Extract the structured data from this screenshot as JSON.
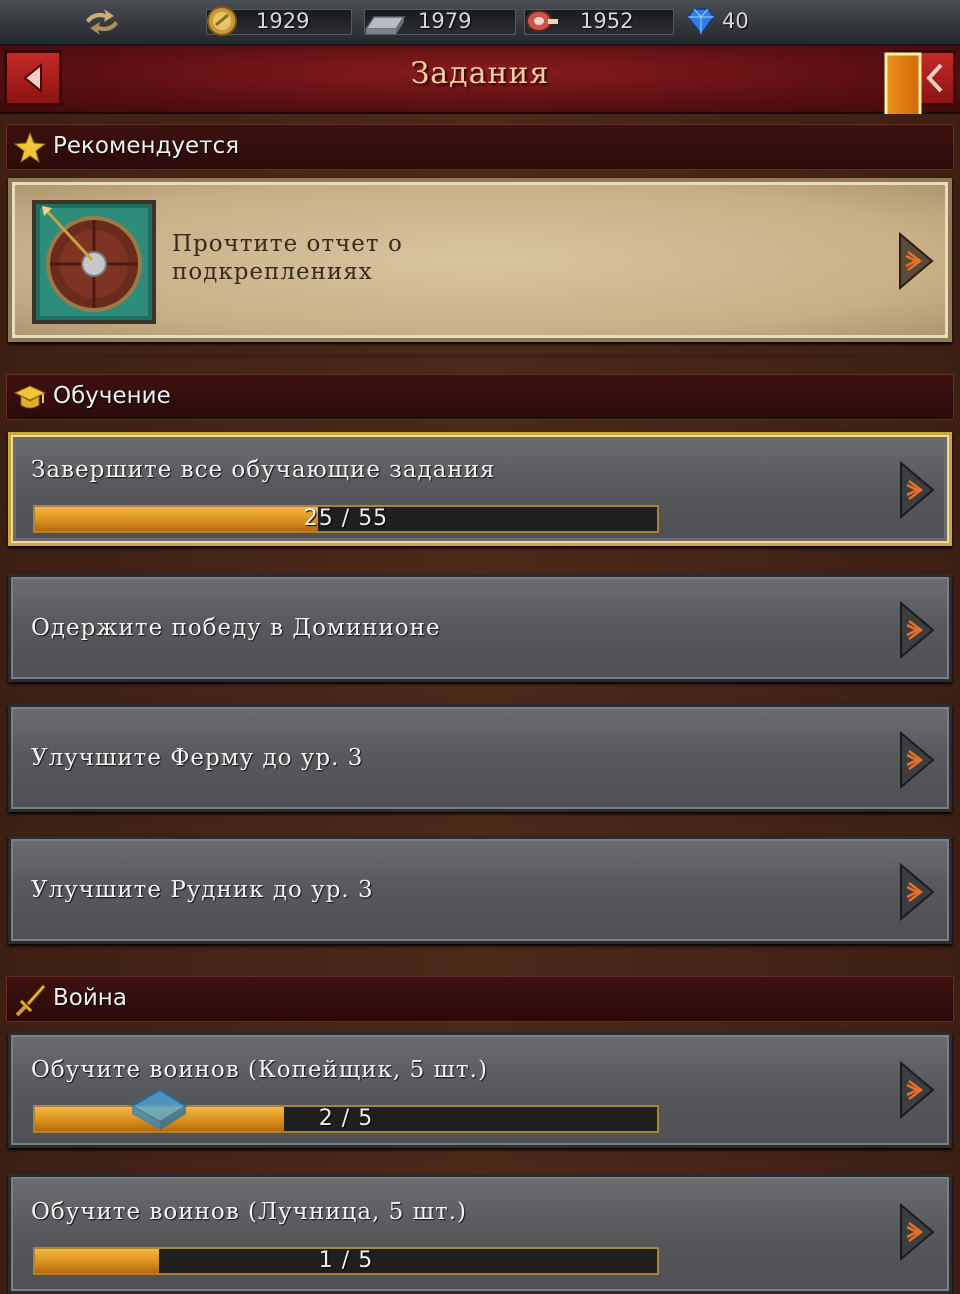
{
  "resources": [
    {
      "name": "gold",
      "value": "1929"
    },
    {
      "name": "iron",
      "value": "1979"
    },
    {
      "name": "food",
      "value": "1952"
    },
    {
      "name": "gems",
      "value": "40"
    }
  ],
  "header": {
    "title": "Задания"
  },
  "sections": {
    "recommended": {
      "title": "Рекомендуется",
      "quest": {
        "text": "Прочтите отчет о подкреплениях"
      }
    },
    "training": {
      "title": "Обучение",
      "quests": [
        {
          "text": "Завершите все обучающие задания",
          "progress": "25 / 55",
          "fraction": 0.455
        },
        {
          "text": "Одержите победу в Доминионе"
        },
        {
          "text": "Улучшите Ферму до ур. 3"
        },
        {
          "text": "Улучшите Рудник до ур. 3"
        }
      ]
    },
    "war": {
      "title": "Война",
      "quests": [
        {
          "text": "Обучите воинов (Копейщик, 5 шт.)",
          "progress": "2 / 5",
          "fraction": 0.4
        },
        {
          "text": "Обучите воинов (Лучница, 5 шт.)",
          "progress": "1 / 5",
          "fraction": 0.2
        }
      ]
    }
  },
  "colors": {
    "accent": "#e0951f",
    "header_red": "#8a1c1e",
    "card_gray": "#5a5c60",
    "gold_border": "#c9a845"
  }
}
